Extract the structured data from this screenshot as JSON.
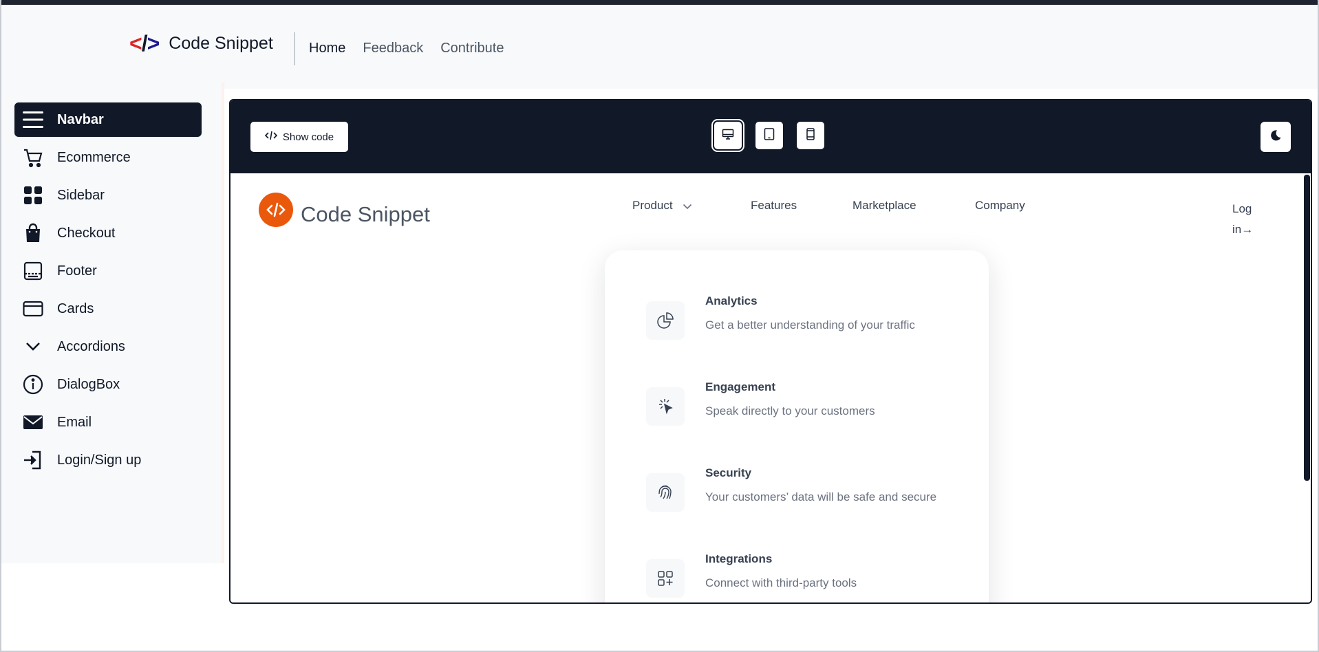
{
  "header": {
    "brand_name": "Code Snippet",
    "nav": [
      {
        "label": "Home",
        "active": true
      },
      {
        "label": "Feedback",
        "active": false
      },
      {
        "label": "Contribute",
        "active": false
      }
    ]
  },
  "sidebar": {
    "items": [
      {
        "label": "Navbar",
        "icon": "menu-icon",
        "active": true
      },
      {
        "label": "Ecommerce",
        "icon": "cart-icon"
      },
      {
        "label": "Sidebar",
        "icon": "grid-icon"
      },
      {
        "label": "Checkout",
        "icon": "bag-icon"
      },
      {
        "label": "Footer",
        "icon": "footer-icon"
      },
      {
        "label": "Cards",
        "icon": "card-icon"
      },
      {
        "label": "Accordions",
        "icon": "chevron-down-icon"
      },
      {
        "label": "DialogBox",
        "icon": "info-icon"
      },
      {
        "label": "Email",
        "icon": "mail-icon"
      },
      {
        "label": "Login/Sign up",
        "icon": "login-icon"
      }
    ]
  },
  "toolbar": {
    "show_code_label": "Show code",
    "viewports": [
      "desktop-icon",
      "tablet-icon",
      "mobile-icon"
    ],
    "active_viewport": "desktop",
    "theme_icon": "moon-icon"
  },
  "preview": {
    "brand_name": "Code Snippet",
    "nav": [
      "Product",
      "Features",
      "Marketplace",
      "Company"
    ],
    "login_label": "Log in→",
    "login_line1": "Log",
    "login_line2": "in→",
    "dropdown": [
      {
        "title": "Analytics",
        "desc": "Get a better understanding of your traffic",
        "icon": "pie-chart-icon"
      },
      {
        "title": "Engagement",
        "desc": "Speak directly to your customers",
        "icon": "cursor-click-icon"
      },
      {
        "title": "Security",
        "desc": "Your customers’ data will be safe and secure",
        "icon": "fingerprint-icon"
      },
      {
        "title": "Integrations",
        "desc": "Connect with third-party tools",
        "icon": "squares-plus-icon"
      }
    ]
  },
  "colors": {
    "dark": "#111827",
    "brand_red": "#dc2626",
    "brand_navy": "#1e1b8f",
    "accent_orange": "#ea580c"
  }
}
